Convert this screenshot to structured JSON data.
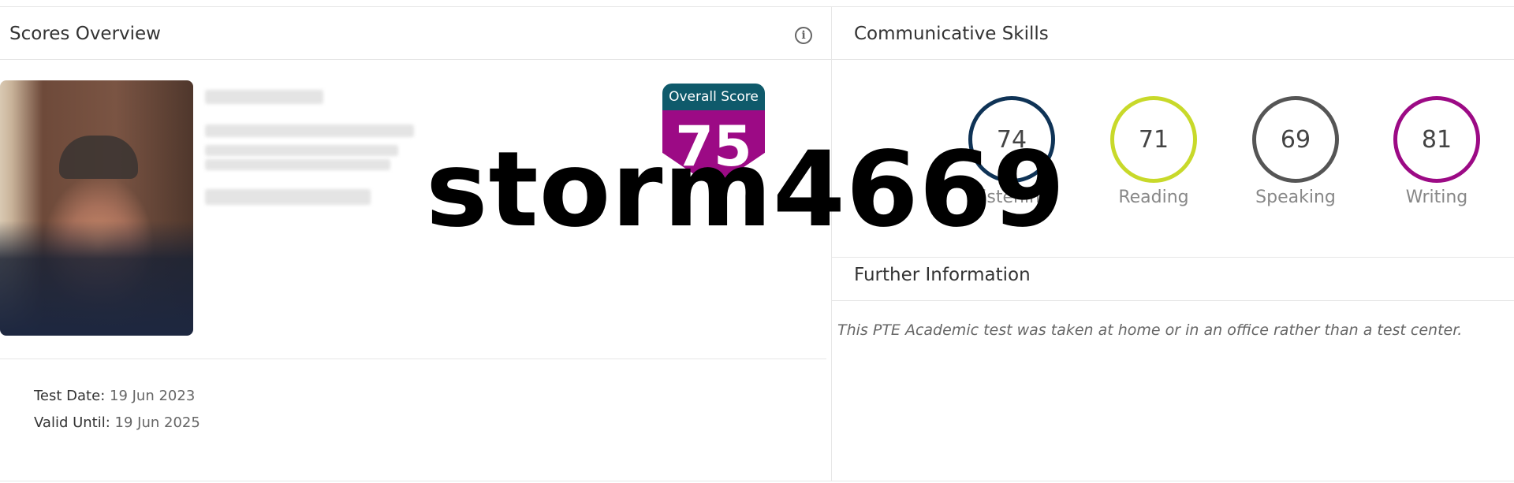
{
  "scores_overview": {
    "title": "Scores Overview",
    "overall_score": {
      "label": "Overall Score",
      "value": "75"
    },
    "test_date": {
      "label": "Test Date:",
      "value": "19 Jun 2023"
    },
    "valid_until": {
      "label": "Valid Until:",
      "value": "19 Jun 2025"
    }
  },
  "communicative_skills": {
    "title": "Communicative Skills",
    "skills": [
      {
        "name": "Listening",
        "score": "74",
        "color": "#0f3356"
      },
      {
        "name": "Reading",
        "score": "71",
        "color": "#c8d92a"
      },
      {
        "name": "Speaking",
        "score": "69",
        "color": "#555555"
      },
      {
        "name": "Writing",
        "score": "81",
        "color": "#9c0a85"
      }
    ]
  },
  "further_information": {
    "title": "Further Information",
    "note": "This PTE Academic test was taken at home or in an office rather than a test center."
  },
  "watermark": {
    "text": "storm4669"
  },
  "colors": {
    "overall_cap": "#0f5a6b",
    "overall_shield": "#9c0a85"
  },
  "icons": {
    "info": "info-icon"
  }
}
